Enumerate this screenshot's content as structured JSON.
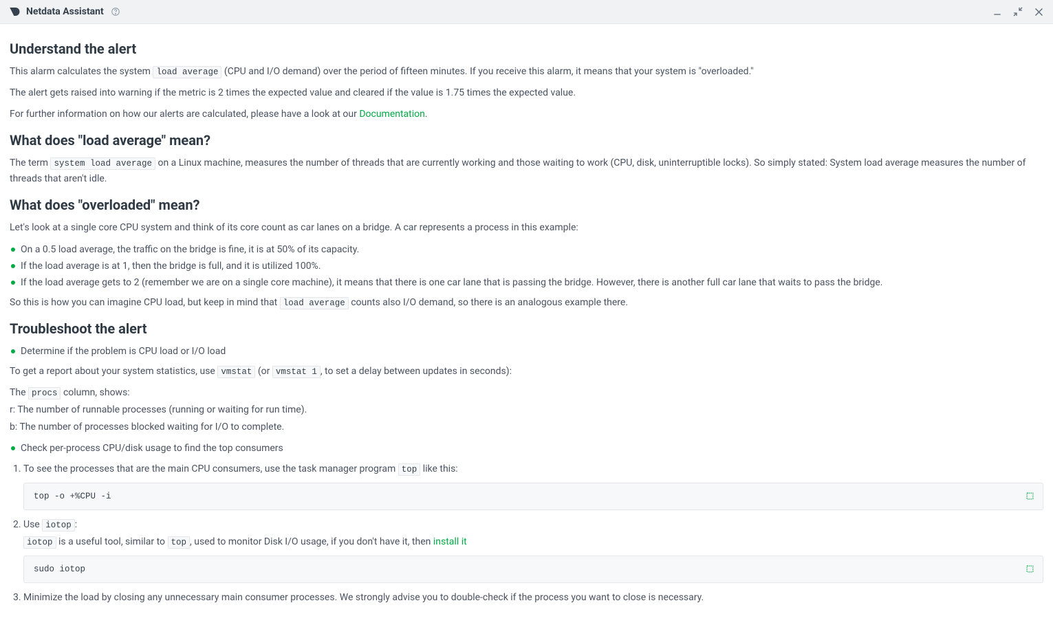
{
  "header": {
    "title": "Netdata Assistant"
  },
  "sections": {
    "understand": {
      "heading": "Understand the alert",
      "p1_a": "This alarm calculates the system ",
      "p1_code": "load average",
      "p1_b": " (CPU and I/O demand) over the period of fifteen minutes. If you receive this alarm, it means that your system is \"overloaded.\"",
      "p2": "The alert gets raised into warning if the metric is 2 times the expected value and cleared if the value is 1.75 times the expected value.",
      "p3_a": "For further information on how our alerts are calculated, please have a look at our ",
      "p3_link": "Documentation",
      "p3_b": "."
    },
    "load_avg": {
      "heading": "What does \"load average\" mean?",
      "p1_a": "The term ",
      "p1_code": "system load average",
      "p1_b": " on a Linux machine, measures the number of threads that are currently working and those waiting to work (CPU, disk, uninterruptible locks). So simply stated: System load average measures the number of threads that aren't idle."
    },
    "overloaded": {
      "heading": "What does \"overloaded\" mean?",
      "p1": "Let's look at a single core CPU system and think of its core count as car lanes on a bridge. A car represents a process in this example:",
      "bullets": [
        "On a 0.5 load average, the traffic on the bridge is fine, it is at 50% of its capacity.",
        "If the load average is at 1, then the bridge is full, and it is utilized 100%.",
        "If the load average gets to 2 (remember we are on a single core machine), it means that there is one car lane that is passing the bridge. However, there is another full car lane that waits to pass the bridge."
      ],
      "p2_a": "So this is how you can imagine CPU load, but keep in mind that ",
      "p2_code": "load average",
      "p2_b": " counts also I/O demand, so there is an analogous example there."
    },
    "troubleshoot": {
      "heading": "Troubleshoot the alert",
      "b1": "Determine if the problem is CPU load or I/O load",
      "p1_a": "To get a report about your system statistics, use ",
      "p1_code1": "vmstat",
      "p1_mid": " (or ",
      "p1_code2": "vmstat 1",
      "p1_b": ", to set a delay between updates in seconds):",
      "p2_a": "The ",
      "p2_code": "procs",
      "p2_b": " column, shows:",
      "p3": "r: The number of runnable processes (running or waiting for run time).",
      "p4": "b: The number of processes blocked waiting for I/O to complete.",
      "b2": "Check per-process CPU/disk usage to find the top consumers",
      "ol1_a": "To see the processes that are the main CPU consumers, use the task manager program ",
      "ol1_code": "top",
      "ol1_b": " like this:",
      "cb1": "top -o +%CPU -i",
      "ol2_a": "Use ",
      "ol2_code": "iotop",
      "ol2_b": ":",
      "ol2_sub_code1": "iotop",
      "ol2_sub_a": " is a useful tool, similar to ",
      "ol2_sub_code2": "top",
      "ol2_sub_b": ", used to monitor Disk I/O usage, if you don't have it, then ",
      "ol2_sub_link": "install it",
      "cb2": "sudo iotop",
      "ol3": "Minimize the load by closing any unnecessary main consumer processes. We strongly advise you to double-check if the process you want to close is necessary."
    }
  }
}
